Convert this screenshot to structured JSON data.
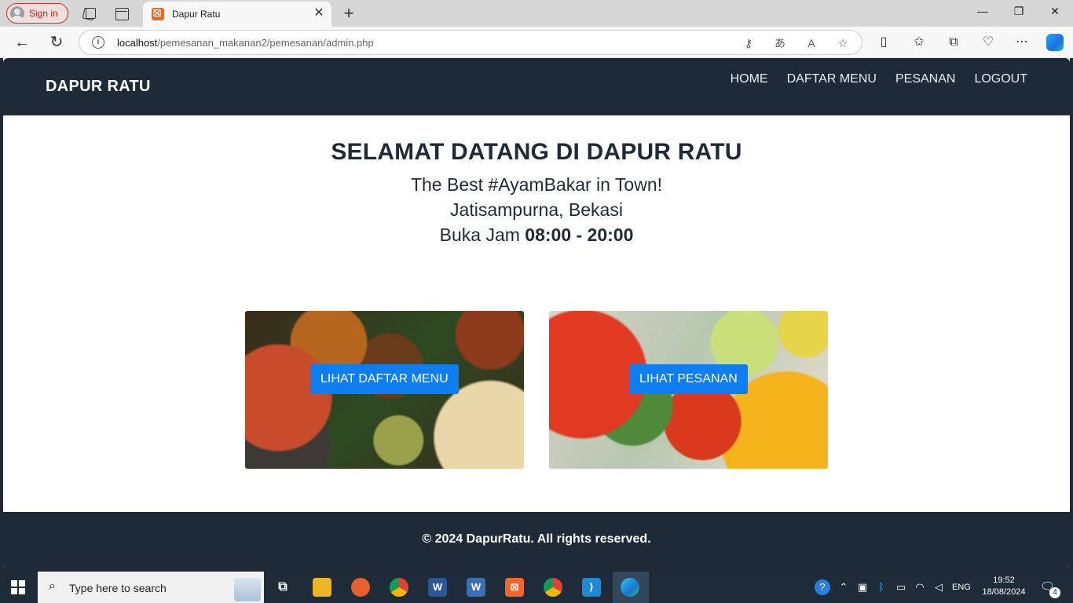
{
  "browser": {
    "signin_label": "Sign in",
    "tab_title": "Dapur Ratu",
    "url_host": "localhost",
    "url_path": "/pemesanan_makanan2/pemesanan/admin.php"
  },
  "site": {
    "brand": "DAPUR RATU",
    "nav": [
      "HOME",
      "DAFTAR MENU",
      "PESANAN",
      "LOGOUT"
    ],
    "hero": {
      "title": "SELAMAT DATANG DI DAPUR RATU",
      "tagline": "The Best #AyamBakar in Town!",
      "location": "Jatisampurna, Bekasi",
      "hours_prefix": "Buka Jam ",
      "hours": "08:00 - 20:00"
    },
    "cards": [
      {
        "button": "LIHAT DAFTAR MENU",
        "image": "food-photo"
      },
      {
        "button": "LIHAT PESANAN",
        "image": "drinks-photo"
      }
    ],
    "footer": "© 2024 DapurRatu. All rights reserved."
  },
  "taskbar": {
    "search_placeholder": "Type here to search",
    "language": "ENG",
    "time": "19:52",
    "date": "18/08/2024",
    "notifications": "4"
  }
}
